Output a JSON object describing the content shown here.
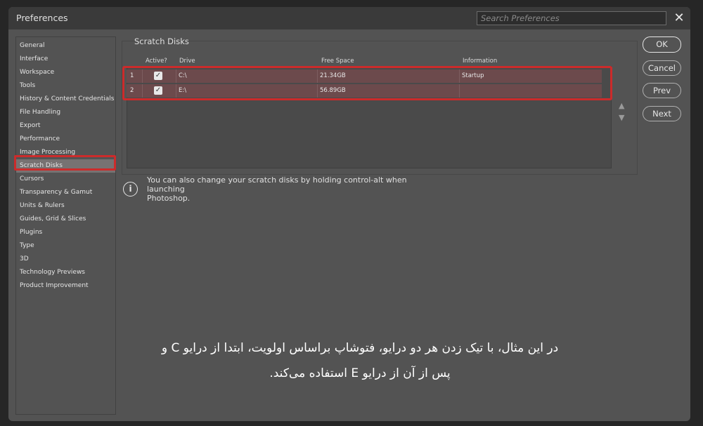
{
  "window": {
    "title": "Preferences",
    "search_placeholder": "Search Preferences"
  },
  "sidebar": {
    "items": [
      {
        "label": "General"
      },
      {
        "label": "Interface"
      },
      {
        "label": "Workspace"
      },
      {
        "label": "Tools"
      },
      {
        "label": "History & Content Credentials"
      },
      {
        "label": "File Handling"
      },
      {
        "label": "Export"
      },
      {
        "label": "Performance"
      },
      {
        "label": "Image Processing"
      },
      {
        "label": "Scratch Disks",
        "selected": true
      },
      {
        "label": "Cursors"
      },
      {
        "label": "Transparency & Gamut"
      },
      {
        "label": "Units & Rulers"
      },
      {
        "label": "Guides, Grid & Slices"
      },
      {
        "label": "Plugins"
      },
      {
        "label": "Type"
      },
      {
        "label": "3D"
      },
      {
        "label": "Technology Previews"
      },
      {
        "label": "Product Improvement"
      }
    ]
  },
  "scratch_disks": {
    "group_title": "Scratch Disks",
    "columns": [
      "Active?",
      "Drive",
      "Free Space",
      "Information"
    ],
    "rows": [
      {
        "index": "1",
        "active": true,
        "drive": "C:\\",
        "free_space": "21.34GB",
        "information": "Startup"
      },
      {
        "index": "2",
        "active": true,
        "drive": "E:\\",
        "free_space": "56.89GB",
        "information": ""
      }
    ],
    "move_up_icon": "triangle-up-icon",
    "move_down_icon": "triangle-down-icon"
  },
  "info": {
    "icon": "info-icon",
    "text_line1": "You can also change your scratch disks by holding control-alt when launching",
    "text_line2": "Photoshop."
  },
  "buttons": {
    "ok": "OK",
    "cancel": "Cancel",
    "prev": "Prev",
    "next": "Next"
  },
  "annotation": {
    "line1": "در این مثال، با تیک زدن هر دو درایو، فتوشاپ براساس اولویت، ابتدا از درایو C و",
    "line2": "پس از آن از درایو E استفاده می‌کند.",
    "highlight_color": "#cc2b2b"
  }
}
